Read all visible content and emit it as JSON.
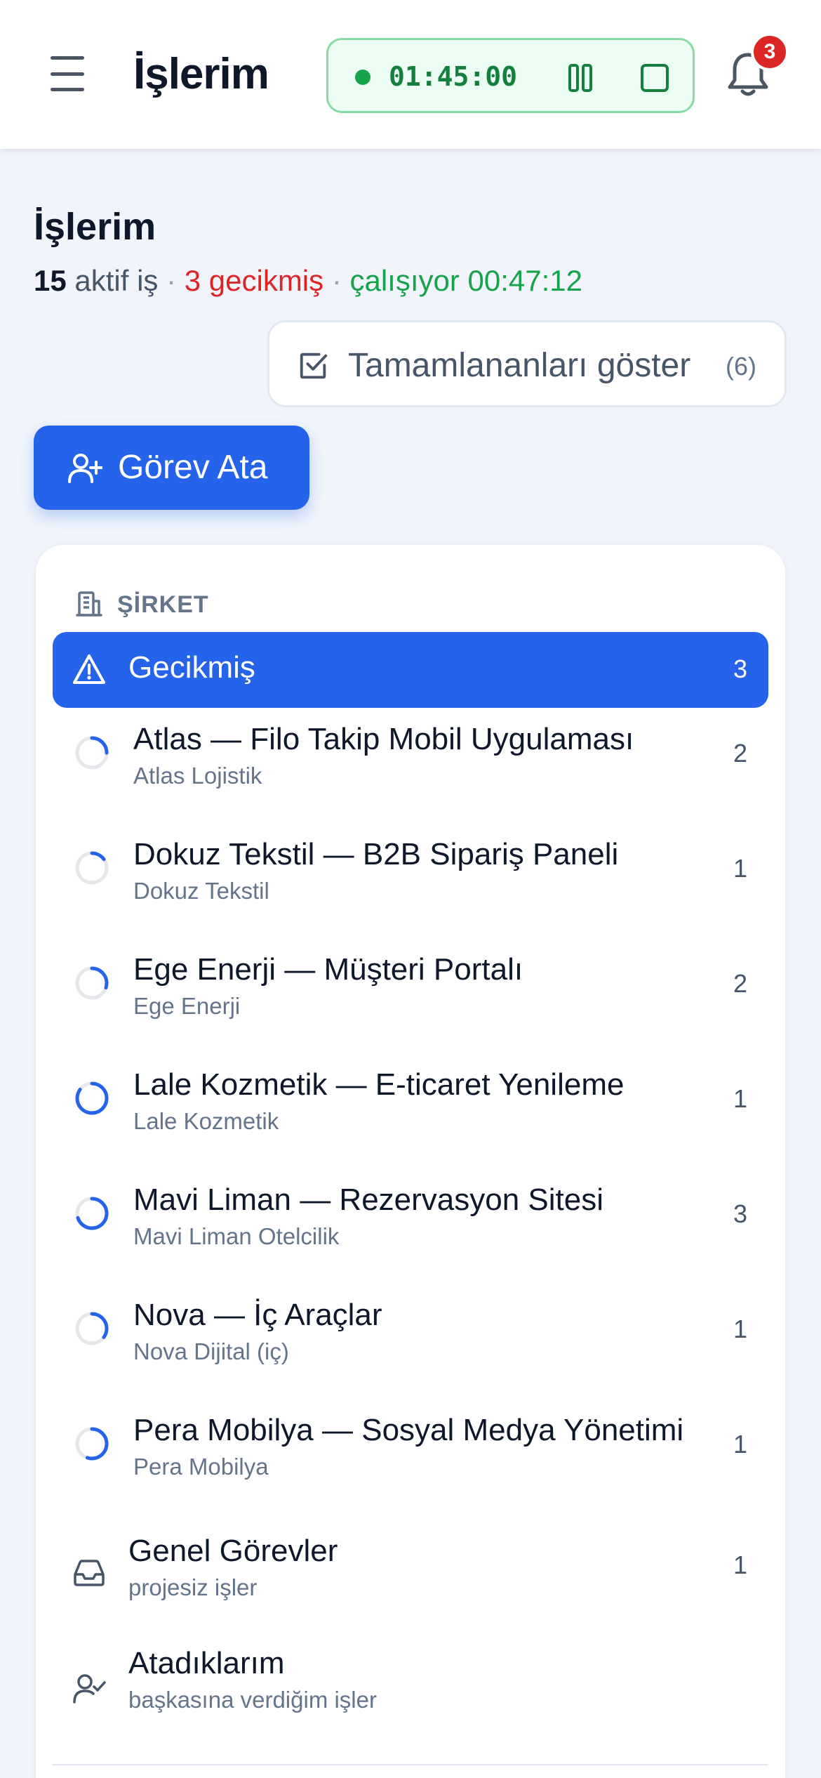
{
  "header": {
    "app_title": "İşlerim",
    "timer": {
      "time": "01:45:00",
      "status_color": "#16a34a"
    },
    "notifications": {
      "count": "3"
    }
  },
  "page": {
    "title": "İşlerim",
    "summary": {
      "active_count": "15",
      "active_label": " aktif iş",
      "separator": " · ",
      "overdue": "3 gecikmiş",
      "running": "çalışıyor 00:47:12"
    },
    "show_completed": {
      "label": "Tamamlananları göster",
      "count": "(6)"
    },
    "assign_button": "Görev Ata"
  },
  "sidebar": {
    "section_label": "ŞİRKET",
    "overdue_item": {
      "label": "Gecikmiş",
      "count": "3"
    },
    "projects": [
      {
        "title": "Atlas — Filo Takip Mobil Uygulaması",
        "client": "Atlas Lojistik",
        "count": "2",
        "progress": 0.25
      },
      {
        "title": "Dokuz Tekstil — B2B Sipariş Paneli",
        "client": "Dokuz Tekstil",
        "count": "1",
        "progress": 0.15
      },
      {
        "title": "Ege Enerji — Müşteri Portalı",
        "client": "Ege Enerji",
        "count": "2",
        "progress": 0.3
      },
      {
        "title": "Lale Kozmetik — E-ticaret Yenileme",
        "client": "Lale Kozmetik",
        "count": "1",
        "progress": 0.85
      },
      {
        "title": "Mavi Liman — Rezervasyon Sitesi",
        "client": "Mavi Liman Otelcilik",
        "count": "3",
        "progress": 0.7
      },
      {
        "title": "Nova — İç Araçlar",
        "client": "Nova Dijital (iç)",
        "count": "1",
        "progress": 0.35
      },
      {
        "title": "Pera Mobilya — Sosyal Medya Yönetimi",
        "client": "Pera Mobilya",
        "count": "1",
        "progress": 0.55
      }
    ],
    "general": {
      "title": "Genel Görevler",
      "sub": "projesiz işler",
      "count": "1"
    },
    "assigned": {
      "title": "Atadıklarım",
      "sub": "başkasına verdiğim işler"
    }
  },
  "colors": {
    "accent": "#2563eb",
    "danger": "#dc2626",
    "success": "#16a34a"
  }
}
